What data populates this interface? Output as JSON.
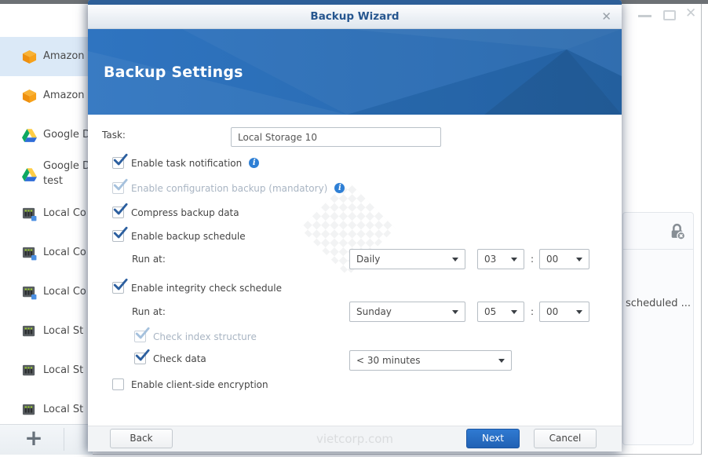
{
  "colors": {
    "header_blue": "#2a6cb5",
    "accent_blue": "#2161b4",
    "check_blue": "#2c5f9f",
    "selected_item_bg": "#dbe9f7",
    "title_text_blue": "#26568f"
  },
  "background_window": {
    "app_logo_icon": "hyper-backup-logo",
    "window_controls": {
      "minimize": "minimize",
      "maximize": "maximize",
      "close": "✕"
    },
    "sidebar": {
      "items": [
        {
          "icon": "amazon-cube-icon",
          "label": "Amazon",
          "label2": "",
          "selected": true
        },
        {
          "icon": "amazon-cube-icon",
          "label": "Amazon",
          "label2": "",
          "selected": false
        },
        {
          "icon": "google-drive-icon",
          "label": "Google D",
          "label2": "",
          "selected": false
        },
        {
          "icon": "google-drive-icon",
          "label": "Google D",
          "label2": "test",
          "selected": false
        },
        {
          "icon": "local-server-copy-icon",
          "label": "Local Co",
          "label2": "",
          "selected": false
        },
        {
          "icon": "local-server-copy-icon",
          "label": "Local Co",
          "label2": "",
          "selected": false
        },
        {
          "icon": "local-server-copy-icon",
          "label": "Local Co",
          "label2": "",
          "selected": false
        },
        {
          "icon": "local-server-icon",
          "label": "Local St",
          "label2": "",
          "selected": false
        },
        {
          "icon": "local-server-icon",
          "label": "Local St",
          "label2": "",
          "selected": false
        },
        {
          "icon": "local-server-icon",
          "label": "Local St",
          "label2": "",
          "selected": false
        }
      ],
      "add_button": "+"
    },
    "right_panel": {
      "icon": "lock-disabled-icon",
      "partial_text": "scheduled ..."
    }
  },
  "dialog": {
    "title": "Backup Wizard",
    "close": "✕",
    "header_title": "Backup Settings",
    "form": {
      "task_label": "Task:",
      "task_value": "Local Storage 10",
      "info_glyph": "i",
      "rows": [
        {
          "label": "Enable task notification",
          "state": "checked",
          "info": true
        },
        {
          "label": "Enable configuration backup (mandatory)",
          "state": "checked-disabled",
          "info": true
        },
        {
          "label": "Compress backup data",
          "state": "checked",
          "info": false
        },
        {
          "label": "Enable backup schedule",
          "state": "checked",
          "info": false
        },
        {
          "label": "Enable integrity check schedule",
          "state": "checked",
          "info": false
        },
        {
          "label": "Check index structure",
          "state": "checked-disabled",
          "info": false
        },
        {
          "label": "Check data",
          "state": "checked",
          "info": false
        },
        {
          "label": "Enable client-side encryption",
          "state": "unchecked",
          "info": false
        }
      ],
      "run_at_label_1": "Run at:",
      "run_at_label_2": "Run at:",
      "colon": ":",
      "backup_schedule": {
        "frequency": "Daily",
        "hour": "03",
        "minute": "00"
      },
      "integrity_schedule": {
        "frequency": "Sunday",
        "hour": "05",
        "minute": "00"
      },
      "check_data_duration": "< 30 minutes"
    },
    "footer": {
      "back": "Back",
      "next": "Next",
      "cancel": "Cancel",
      "watermark": "vietcorp.com"
    }
  }
}
